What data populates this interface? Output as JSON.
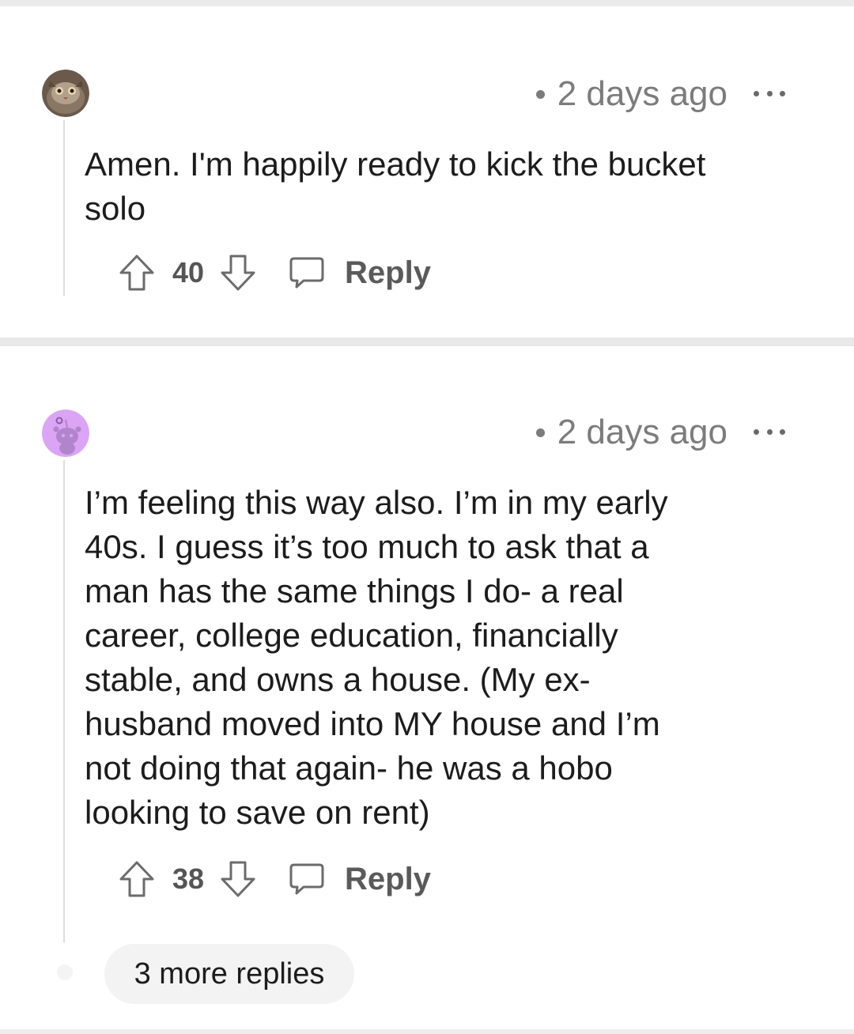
{
  "comments": [
    {
      "timestamp": "2 days ago",
      "text": "Amen. I'm happily ready to kick the bucket\nsolo",
      "score": "40",
      "reply_label": "Reply",
      "avatar": "cat-photo-avatar"
    },
    {
      "timestamp": "2 days ago",
      "text": "I’m feeling this way also. I’m in my early\n40s. I guess it’s too much to ask that a\nman has the same things I do- a real\ncareer, college education, financially\nstable, and owns a house. (My ex-\nhusband moved into MY house and I’m\nnot doing that again- he was a hobo\nlooking to save on rent)",
      "score": "38",
      "reply_label": "Reply",
      "avatar": "snoo-avatar",
      "more_replies": "3 more replies"
    }
  ],
  "icons": {
    "upvote": "upvote-arrow-icon",
    "downvote": "downvote-arrow-icon",
    "reply": "speech-bubble-icon",
    "overflow": "ellipsis-icon"
  },
  "colors": {
    "muted_text": "#7c7c7c",
    "snoo_avatar_bg": "#dba4f4",
    "thread_line": "#dcdcdc"
  }
}
